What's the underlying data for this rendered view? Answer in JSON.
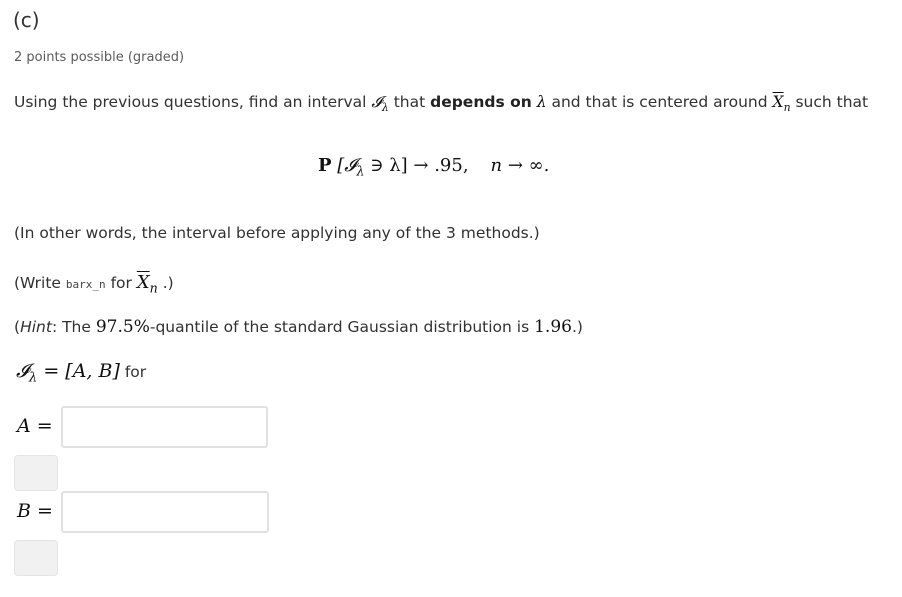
{
  "problem": {
    "part_label": "(c)",
    "points_text": "2 points possible (graded)",
    "question": {
      "intro": "Using the previous questions, find an interval ",
      "interval_symbol": "𝓘",
      "lambda": "λ",
      "that": " that ",
      "depends_on": "depends on",
      "lambda2": " λ",
      "centered_text": " and that is centered around ",
      "xbar": "X",
      "n_sub": "n",
      "such_that": " such that"
    },
    "display_equation": {
      "prob": "P",
      "body": "[𝓘",
      "lambda_sub": "λ",
      "rest": " ∋ λ] → .95,",
      "n_part": "n → ∞."
    },
    "note1": "(In other words, the interval before applying any of the 3 methods.)",
    "note2": {
      "prefix": "(Write ",
      "code": "barx_n",
      "mid": " for ",
      "xbar": "X",
      "n_sub": "n",
      "suffix": " .)"
    },
    "hint": {
      "open": "(",
      "label": "Hint",
      "text1": ": The ",
      "quantile": "97.5%",
      "text2": "-quantile of the standard Gaussian distribution is ",
      "value": "1.96",
      "close": ".)"
    },
    "interval_def": {
      "symbol": "𝓘",
      "sub": "λ",
      "eq": " = [A, B]",
      "for": " for"
    },
    "answers": [
      {
        "label": "A =",
        "value": "",
        "placeholder": ""
      },
      {
        "label": "B =",
        "value": "",
        "placeholder": ""
      }
    ]
  }
}
